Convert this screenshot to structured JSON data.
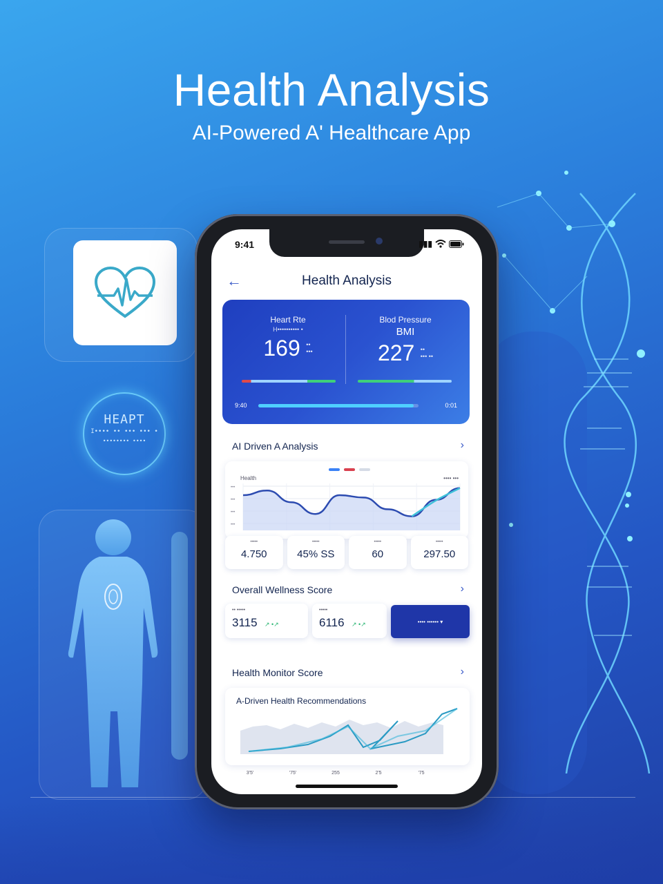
{
  "hero": {
    "title": "Health Analysis",
    "subtitle": "AI-Powered A' Healthcare App"
  },
  "decor": {
    "heart_ring": {
      "line1": "HEAPT",
      "line2": "I•••• •• ••• ••• •",
      "line3": "•••••••• ••••"
    },
    "app_icon": "heart-pulse-icon",
    "silhouette": "human-body-icon",
    "dna": "dna-helix-icon"
  },
  "status_bar": {
    "time": "9:41",
    "signal": "▮▮▮",
    "wifi": "wifi",
    "battery": "battery"
  },
  "nav": {
    "back": "←",
    "title": "Health Analysis"
  },
  "vitals": {
    "left": {
      "label": "Heart Rte",
      "sublabel": "H•••••••••• •",
      "value": "169",
      "unit_top": "••",
      "unit_bottom": "•••"
    },
    "right": {
      "label": "Blod Pressure",
      "sublabel": "BMI",
      "value": "227",
      "unit_top": "••",
      "unit_bottom": "••• ••"
    },
    "progress_left_label": "9:40",
    "progress_right_label": "0:01",
    "progress": 0.97,
    "colors": {
      "red": "#e04a4a",
      "green": "#3fd07a",
      "track": "#9fd4ff"
    }
  },
  "analysis": {
    "heading": "AI Driven A Analysis",
    "chev": "›",
    "legend_colors": [
      "#3b82f6",
      "#d9414f",
      "#d5dbe6"
    ],
    "chart_left_label": "Health",
    "chart_right_label": "•••• •••",
    "y_ticks": [
      "•••",
      "•••",
      "•••",
      "•••"
    ],
    "stats": [
      {
        "label": "•••••",
        "value": "4.750"
      },
      {
        "label": "•••••",
        "value": "45% SS"
      },
      {
        "label": "•••••",
        "value": "60"
      },
      {
        "label": "•••••",
        "value": "297.50"
      }
    ]
  },
  "wellness": {
    "heading": "Overall Wellness Score",
    "chev": "›",
    "box1": {
      "label": "•• •••••",
      "value": "3115",
      "trend": "↗ •↗"
    },
    "box2": {
      "label": "•••••",
      "value": "6116",
      "trend": "↗ •↗"
    },
    "button": "•••• •••••• ▾"
  },
  "monitor": {
    "heading": "Health Monitor Score",
    "chev": "›",
    "card_title": "A-Driven Health Recommendations",
    "x_ticks": [
      "3'5'",
      "'75'",
      "255",
      "2'5",
      "'75"
    ]
  },
  "chart_data": {
    "type": "line",
    "title": "AI Driven A Analysis",
    "series": [
      {
        "values": [
          30,
          34,
          24,
          14,
          30,
          28,
          18,
          12,
          26,
          36
        ]
      }
    ],
    "area": true,
    "grid": true
  }
}
